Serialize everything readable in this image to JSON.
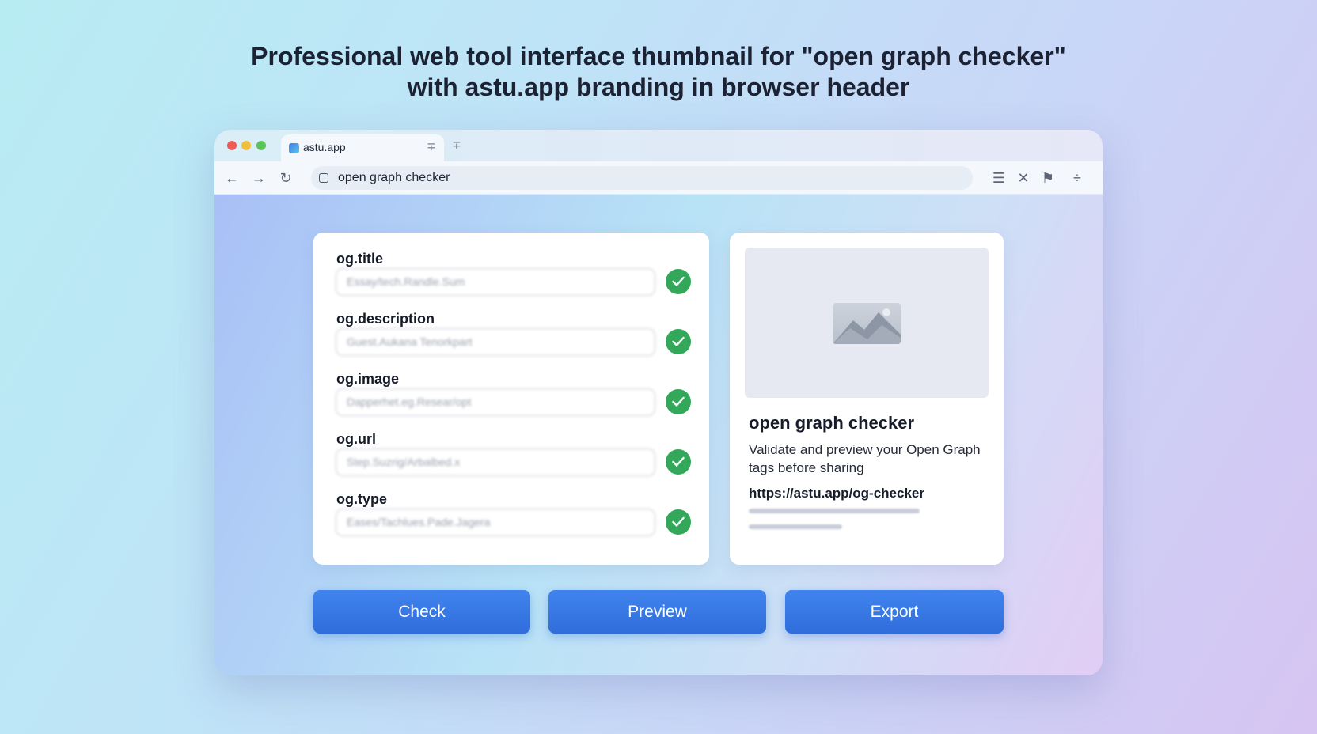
{
  "headline": {
    "line1": "Professional web tool interface thumbnail for \"open graph checker\"",
    "line2": "with astu.app branding in browser header"
  },
  "browser": {
    "tab_title": "astu.app",
    "address": "open graph checker"
  },
  "fields": [
    {
      "label": "og.title",
      "value": "Essay/tech.Randle.Sum",
      "status": "valid"
    },
    {
      "label": "og.description",
      "value": "Guest.Aukana Tenorkpart",
      "status": "valid"
    },
    {
      "label": "og.image",
      "value": "Dapperhet.eg.Resear/opt",
      "status": "valid"
    },
    {
      "label": "og.url",
      "value": "Step.Suzrig/Arbalbed.x",
      "status": "valid"
    },
    {
      "label": "og.type",
      "value": "Eases/Tachlues.Pade.Jagera",
      "status": "valid"
    }
  ],
  "preview": {
    "title": "open graph checker",
    "description": "Validate and preview your Open Graph tags before sharing",
    "url": "https://astu.app/og-checker"
  },
  "actions": {
    "check": "Check",
    "preview": "Preview",
    "export": "Export"
  },
  "colors": {
    "accent": "#3a7ae6",
    "success": "#34a85a"
  },
  "icons": [
    "back-arrow-icon",
    "forward-arrow-icon",
    "reload-icon",
    "lock-icon",
    "menu-icon",
    "close-icon",
    "extension-icon",
    "more-icon",
    "check-icon",
    "image-icon"
  ]
}
